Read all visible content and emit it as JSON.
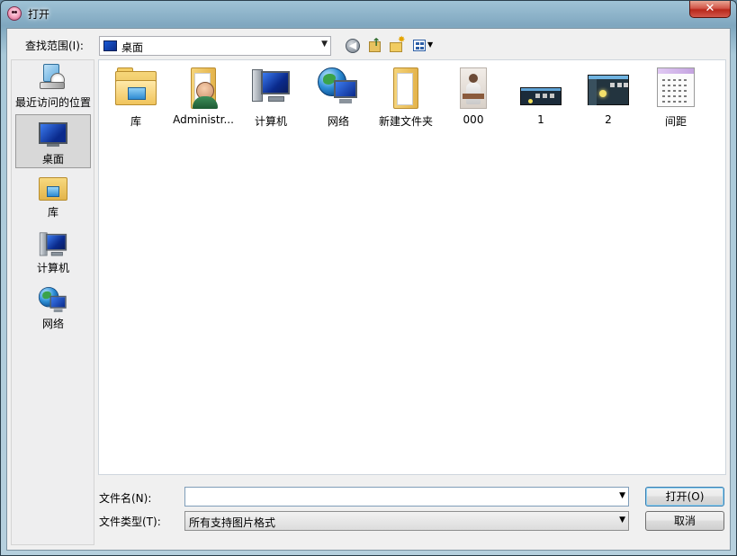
{
  "window": {
    "title": "打开",
    "close_glyph": "✕"
  },
  "lookin": {
    "label": "查找范围(I):",
    "value": "桌面"
  },
  "toolbar": {
    "back_glyph": "◀",
    "up_glyph": "↑",
    "new_glyph": "✸",
    "view_dropdown": "▼"
  },
  "places": [
    {
      "label": "最近访问的位置",
      "icon": "recent-places-icon"
    },
    {
      "label": "桌面",
      "icon": "desktop-icon",
      "selected": true
    },
    {
      "label": "库",
      "icon": "library-icon"
    },
    {
      "label": "计算机",
      "icon": "computer-icon"
    },
    {
      "label": "网络",
      "icon": "network-icon"
    }
  ],
  "items": [
    {
      "label": "库",
      "icon": "library-folder-icon"
    },
    {
      "label": "Administr...",
      "icon": "user-folder-icon"
    },
    {
      "label": "计算机",
      "icon": "computer-icon"
    },
    {
      "label": "网络",
      "icon": "network-icon"
    },
    {
      "label": "新建文件夹",
      "icon": "folder-icon"
    },
    {
      "label": "000",
      "icon": "photo-thumbnail-icon"
    },
    {
      "label": "1",
      "icon": "screenshot-thumbnail-icon"
    },
    {
      "label": "2",
      "icon": "screenshot-thumbnail-icon"
    },
    {
      "label": "间距",
      "icon": "document-thumbnail-icon"
    }
  ],
  "filename": {
    "label": "文件名(N):",
    "value": "",
    "placeholder": ""
  },
  "filetype": {
    "label": "文件类型(T):",
    "value": "所有支持图片格式"
  },
  "buttons": {
    "open": "打开(O)",
    "cancel": "取消"
  },
  "dropdown_glyph": "▼"
}
